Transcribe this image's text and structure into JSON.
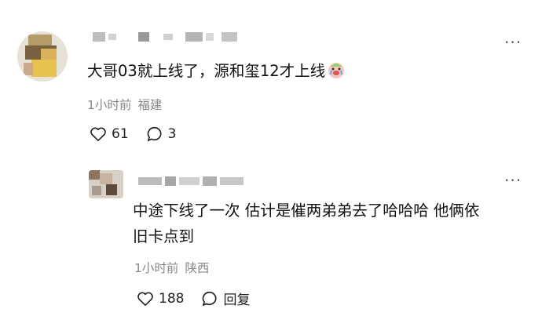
{
  "comments": [
    {
      "text": "大哥03就上线了，源和玺12才上线",
      "emoji_icon": "crying-face-emoji",
      "time": "1小时前",
      "location": "福建",
      "like_count": "61",
      "reply_count": "3"
    },
    {
      "text": "中途下线了一次 估计是催两弟弟去了哈哈哈 他俩依旧卡点到",
      "text_line1": "中途下线了一次 估计是催两弟弟去了哈哈哈 他俩依",
      "text_line2": "旧卡点到",
      "time": "1小时前",
      "location": "陕西",
      "like_count": "188",
      "reply_label": "回复"
    }
  ],
  "icons": {
    "more": "more-dots-icon",
    "like": "heart-outline-icon",
    "comment": "speech-bubble-icon"
  },
  "colors": {
    "text": "#111111",
    "meta": "#888888",
    "icon": "#222222"
  }
}
